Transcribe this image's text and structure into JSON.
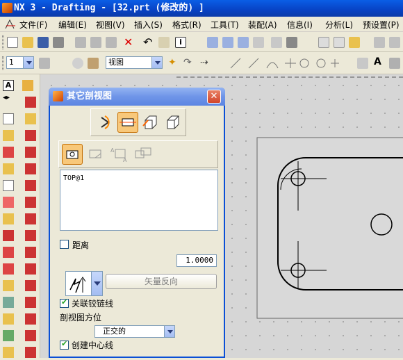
{
  "window": {
    "title": "NX 3 - Drafting - [32.prt  (修改的) ]"
  },
  "menubar": [
    {
      "label": "文件(F)",
      "name": "menu-file"
    },
    {
      "label": "编辑(E)",
      "name": "menu-edit"
    },
    {
      "label": "视图(V)",
      "name": "menu-view"
    },
    {
      "label": "插入(S)",
      "name": "menu-insert"
    },
    {
      "label": "格式(R)",
      "name": "menu-format"
    },
    {
      "label": "工具(T)",
      "name": "menu-tools"
    },
    {
      "label": "装配(A)",
      "name": "menu-assembly"
    },
    {
      "label": "信息(I)",
      "name": "menu-info"
    },
    {
      "label": "分析(L)",
      "name": "menu-analysis"
    },
    {
      "label": "预设置(P)",
      "name": "menu-preferences"
    }
  ],
  "toolbar2": {
    "layer_combo_value": "1",
    "view_combo_value": "视图"
  },
  "dialog": {
    "title": "其它剖视图",
    "view_list": [
      "TOP@1"
    ],
    "distance_label": "距离",
    "distance_value": "1.0000",
    "reverse_vector_label": "矢量反向",
    "associative_hinge_label": "关联铰链线",
    "section_orientation_label": "剖视图方位",
    "orientation_value": "正交的",
    "create_centerline_label": "创建中心线"
  },
  "colors": {
    "titlebar": "#0a4fd6",
    "dialog_title": "#6f95e8",
    "canvas": "#d6d6d6",
    "selected_button": "#f8c87a"
  }
}
